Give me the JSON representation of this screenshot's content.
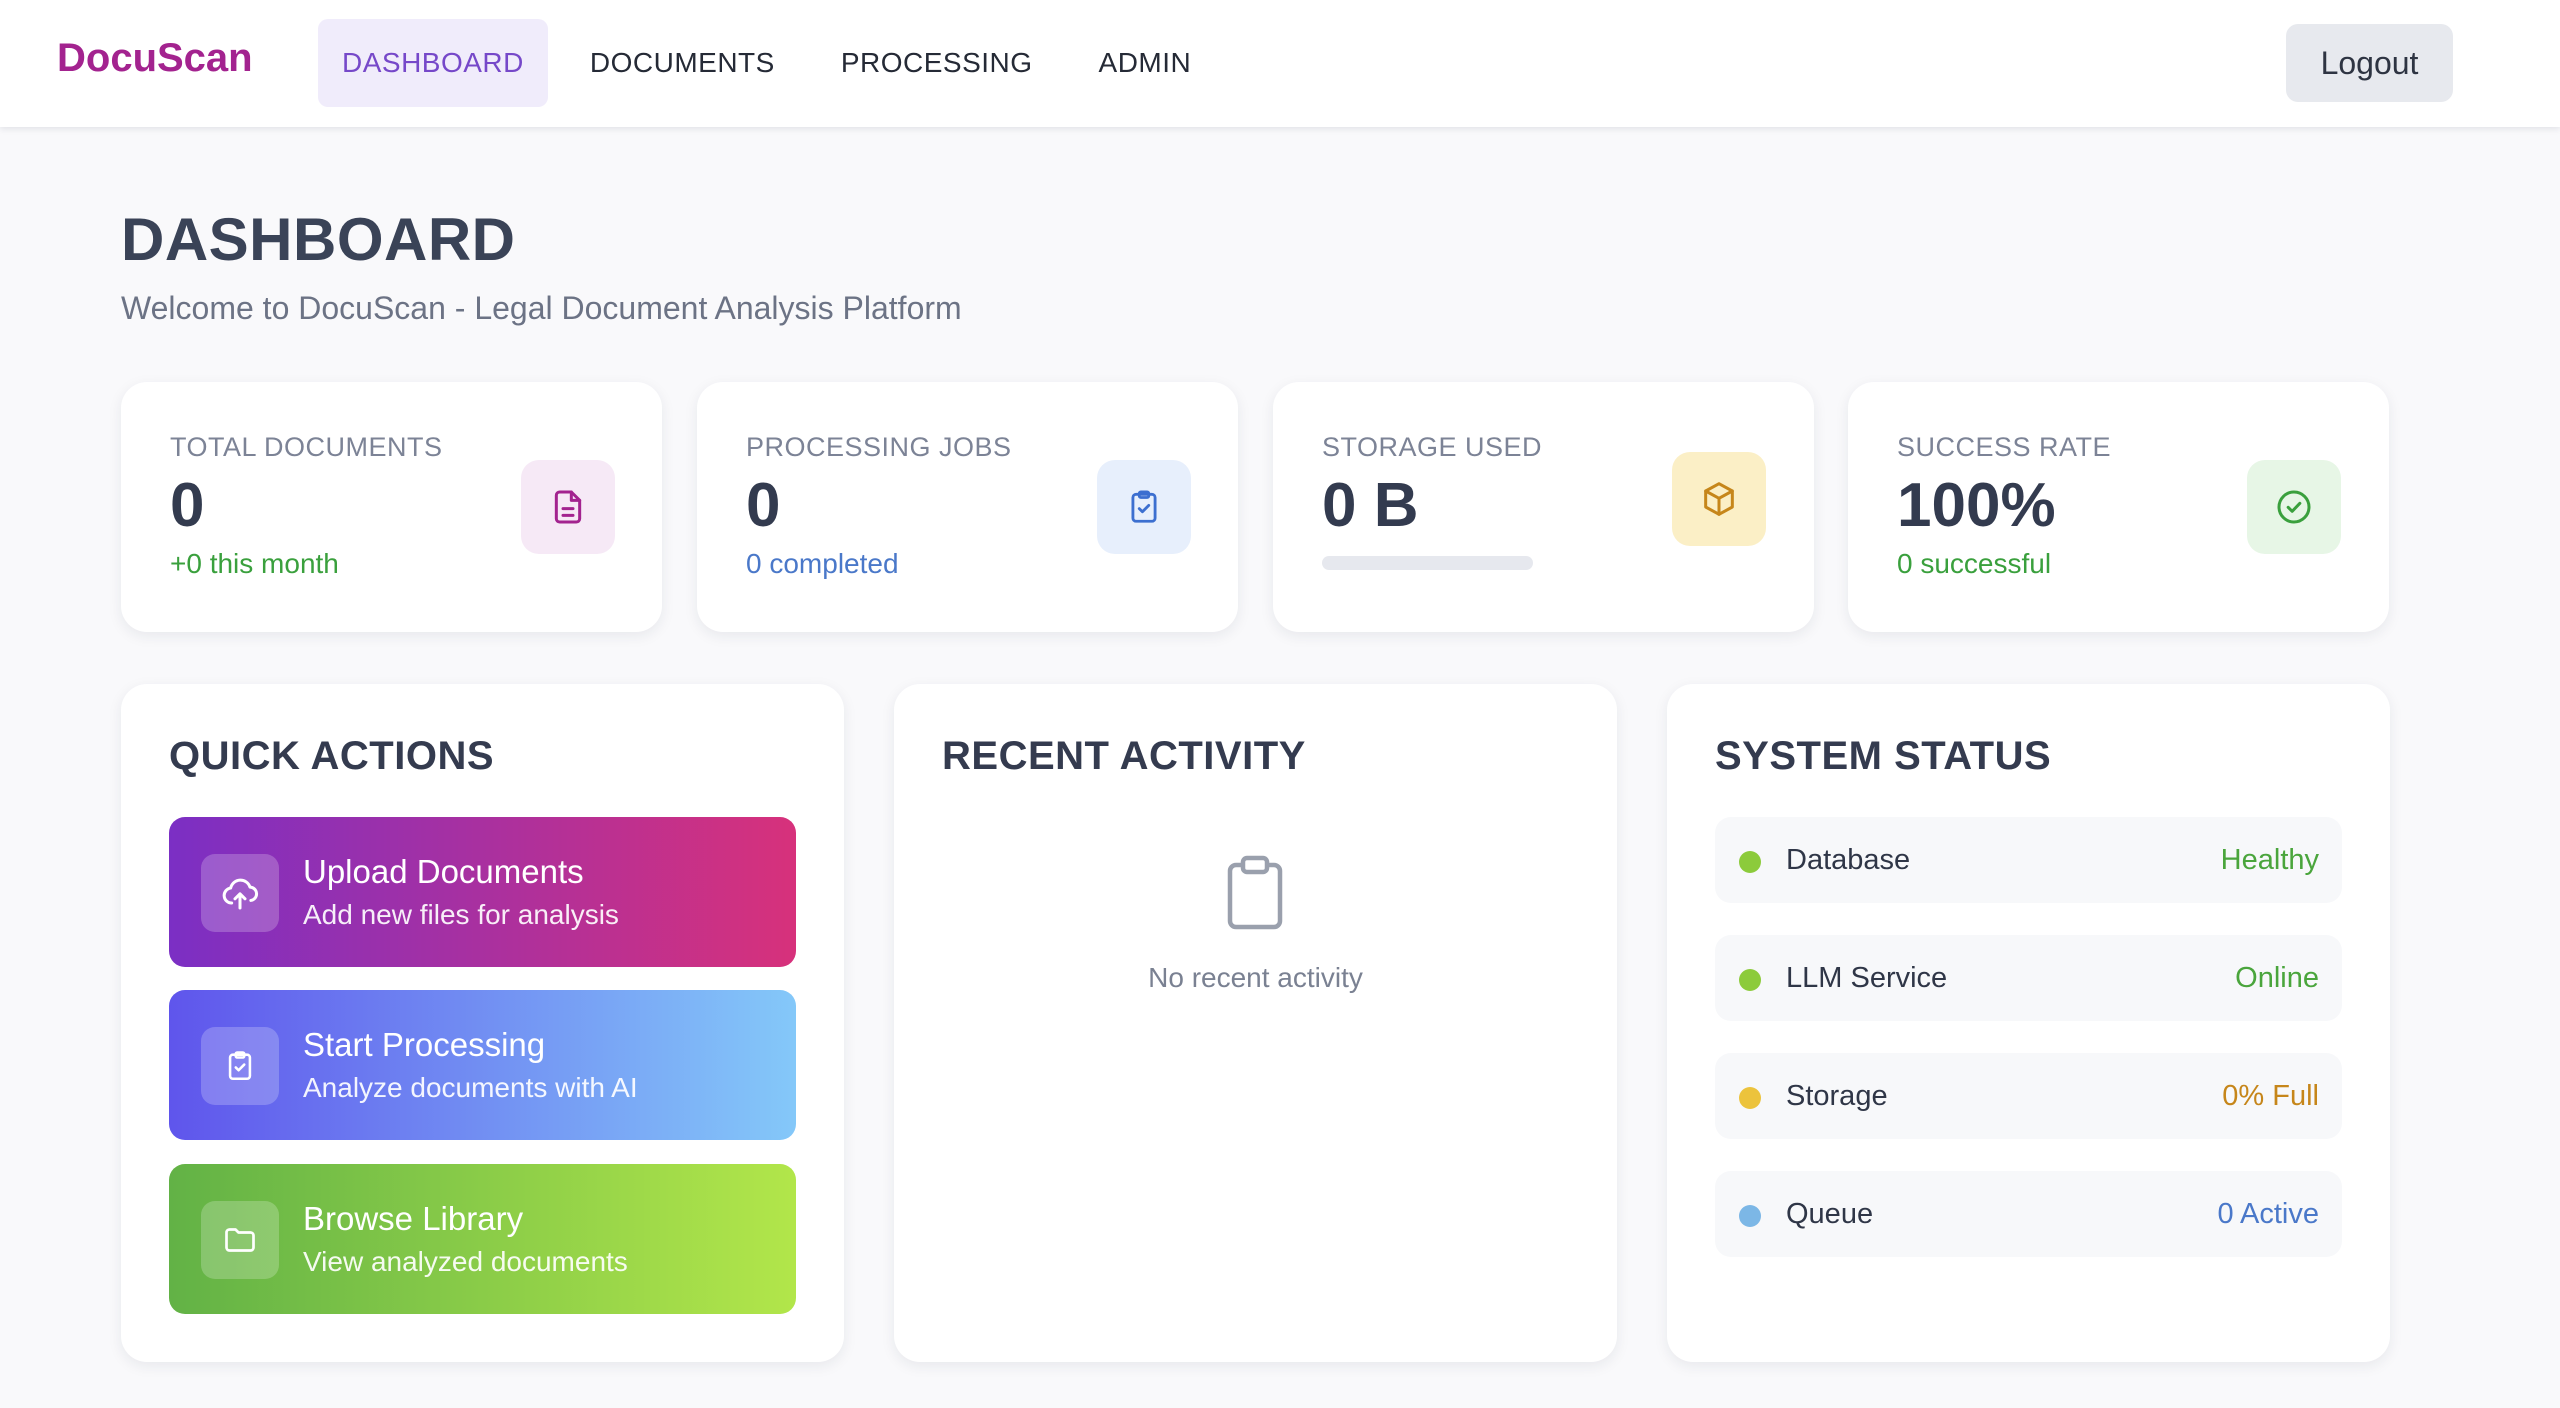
{
  "nav": {
    "brand": "DocuScan",
    "links": [
      {
        "label": "DASHBOARD",
        "active": true
      },
      {
        "label": "DOCUMENTS",
        "active": false
      },
      {
        "label": "PROCESSING",
        "active": false
      },
      {
        "label": "ADMIN",
        "active": false
      }
    ],
    "logout_label": "Logout"
  },
  "header": {
    "title": "DASHBOARD",
    "subtitle": "Welcome to DocuScan - Legal Document Analysis Platform"
  },
  "stats": [
    {
      "label": "TOTAL DOCUMENTS",
      "value": "0",
      "sub": "+0 this month",
      "sub_color": "#3aa03d",
      "icon": "document-icon",
      "icon_bg": "#f6e9f6",
      "icon_color": "#a3238f"
    },
    {
      "label": "PROCESSING JOBS",
      "value": "0",
      "sub": "0 completed",
      "sub_color": "#4a78c9",
      "icon": "clipboard-check-icon",
      "icon_bg": "#e7effc",
      "icon_color": "#3c6fd0"
    },
    {
      "label": "STORAGE USED",
      "value": "0 B",
      "storage_fraction": 0.0,
      "icon": "box-icon",
      "icon_bg": "#fbefc6",
      "icon_color": "#c6861a"
    },
    {
      "label": "SUCCESS RATE",
      "value": "100%",
      "sub": "0 successful",
      "sub_color": "#3aa03d",
      "icon": "check-circle-icon",
      "icon_bg": "#e7f6e6",
      "icon_color": "#3aa03d"
    }
  ],
  "quick_actions": {
    "title": "QUICK ACTIONS",
    "items": [
      {
        "title": "Upload Documents",
        "subtitle": "Add new files for analysis",
        "icon": "cloud-upload-icon",
        "gradient": [
          "#7b2fc4",
          "#d7317b"
        ]
      },
      {
        "title": "Start Processing",
        "subtitle": "Analyze documents with AI",
        "icon": "clipboard-check-icon",
        "gradient": [
          "#5f55ec",
          "#84c8f9"
        ]
      },
      {
        "title": "Browse Library",
        "subtitle": "View analyzed documents",
        "icon": "folder-icon",
        "gradient": [
          "#62b246",
          "#b2e64a"
        ]
      }
    ]
  },
  "recent_activity": {
    "title": "RECENT ACTIVITY",
    "empty_icon": "clipboard-icon",
    "empty_text": "No recent activity"
  },
  "system_status": {
    "title": "SYSTEM STATUS",
    "items": [
      {
        "name": "Database",
        "value": "Healthy",
        "dot_color": "#8ccb3b",
        "value_color": "#4aa53c"
      },
      {
        "name": "LLM Service",
        "value": "Online",
        "dot_color": "#8ccb3b",
        "value_color": "#4aa53c"
      },
      {
        "name": "Storage",
        "value": "0% Full",
        "dot_color": "#ecc33c",
        "value_color": "#c6861a"
      },
      {
        "name": "Queue",
        "value": "0 Active",
        "dot_color": "#7cb7e6",
        "value_color": "#4a78c9"
      }
    ]
  }
}
